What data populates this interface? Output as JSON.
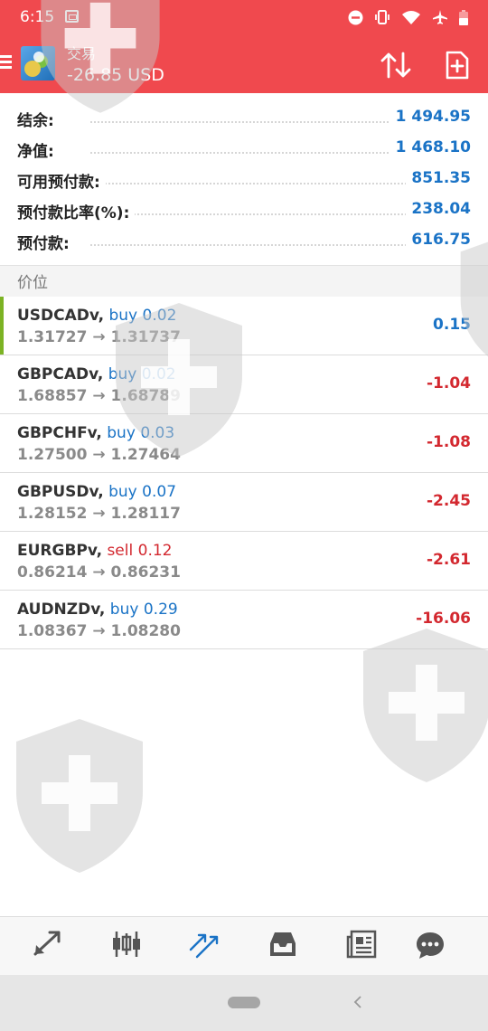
{
  "status_bar": {
    "time": "6:15"
  },
  "header": {
    "title": "交易",
    "profit": "-26.85 USD"
  },
  "summary": [
    {
      "label": "结余:",
      "value": "1 494.95"
    },
    {
      "label": "净值:",
      "value": "1 468.10"
    },
    {
      "label": "可用预付款:",
      "value": "851.35"
    },
    {
      "label": "预付款比率(%):",
      "value": "238.04"
    },
    {
      "label": "预付款:",
      "value": "616.75"
    }
  ],
  "section": {
    "label": "价位"
  },
  "positions": [
    {
      "symbol": "USDCADv",
      "side": "buy",
      "volume": "0.02",
      "open": "1.31727",
      "current": "1.31737",
      "profit": "0.15"
    },
    {
      "symbol": "GBPCADv",
      "side": "buy",
      "volume": "0.02",
      "open": "1.68857",
      "current": "1.68789",
      "profit": "-1.04"
    },
    {
      "symbol": "GBPCHFv",
      "side": "buy",
      "volume": "0.03",
      "open": "1.27500",
      "current": "1.27464",
      "profit": "-1.08"
    },
    {
      "symbol": "GBPUSDv",
      "side": "buy",
      "volume": "0.07",
      "open": "1.28152",
      "current": "1.28117",
      "profit": "-2.45"
    },
    {
      "symbol": "EURGBPv",
      "side": "sell",
      "volume": "0.12",
      "open": "0.86214",
      "current": "0.86231",
      "profit": "-2.61"
    },
    {
      "symbol": "AUDNZDv",
      "side": "buy",
      "volume": "0.29",
      "open": "1.08367",
      "current": "1.08280",
      "profit": "-16.06"
    }
  ],
  "separator": ",",
  "arrow": "→",
  "bottom_nav": {
    "items": [
      {
        "icon": "quotes-icon"
      },
      {
        "icon": "chart-icon"
      },
      {
        "icon": "trade-icon",
        "active": true
      },
      {
        "icon": "history-icon"
      },
      {
        "icon": "news-icon"
      },
      {
        "icon": "chat-icon"
      }
    ]
  },
  "colors": {
    "header_bg": "#f0494e",
    "buy": "#1a73c6",
    "sell": "#d3282f",
    "selected_bar": "#7cb324"
  }
}
